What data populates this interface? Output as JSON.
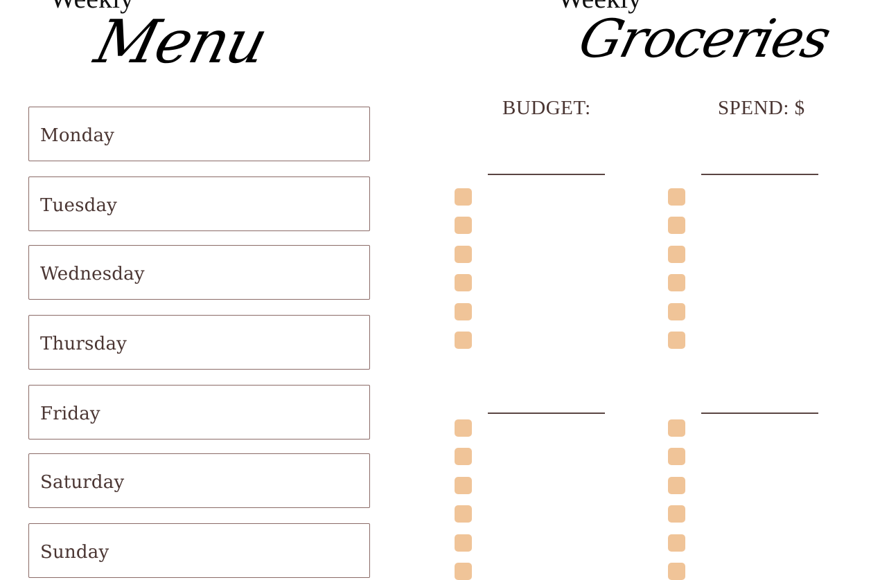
{
  "menu": {
    "title_small": "Weekly",
    "title": "Menu",
    "days": [
      {
        "label": "Monday"
      },
      {
        "label": "Tuesday"
      },
      {
        "label": "Wednesday"
      },
      {
        "label": "Thursday"
      },
      {
        "label": "Friday"
      },
      {
        "label": "Saturday"
      },
      {
        "label": "Sunday"
      }
    ]
  },
  "groceries": {
    "title_small": "Weekly",
    "title": "Groceries",
    "budget_label": "BUDGET:",
    "spend_label": "SPEND: $",
    "checkbox_color": "#f0c498",
    "sections": [
      {
        "column": "left",
        "items_checked": [
          false,
          false,
          false,
          false,
          false,
          false
        ]
      },
      {
        "column": "right",
        "items_checked": [
          false,
          false,
          false,
          false,
          false,
          false
        ]
      },
      {
        "column": "left",
        "items_checked": [
          false,
          false,
          false,
          false,
          false,
          false
        ]
      },
      {
        "column": "right",
        "items_checked": [
          false,
          false,
          false,
          false,
          false,
          false
        ]
      }
    ]
  }
}
